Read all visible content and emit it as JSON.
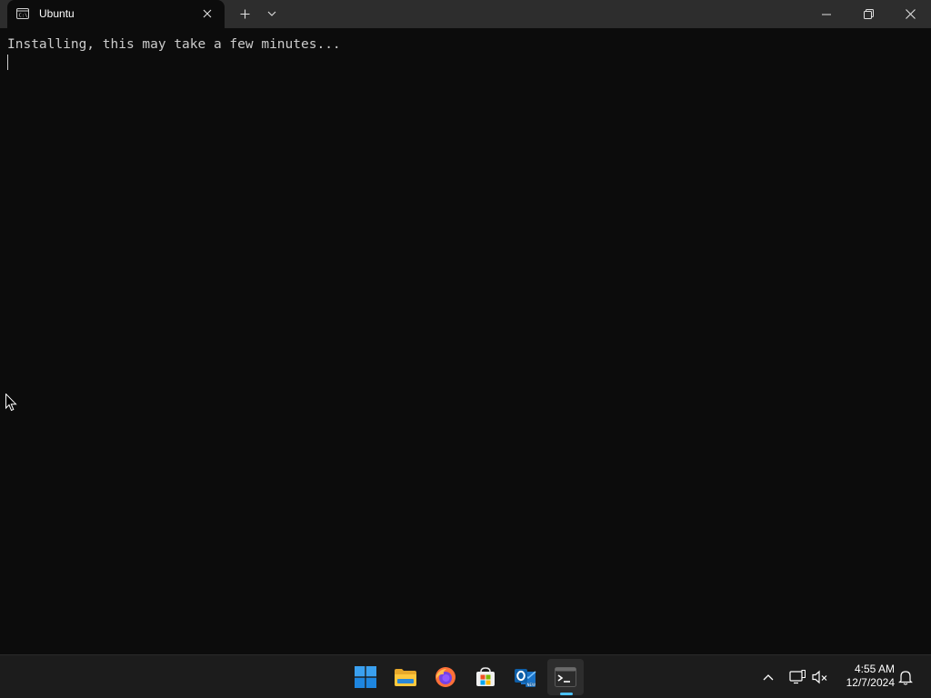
{
  "window": {
    "tab": {
      "title": "Ubuntu",
      "icon": "terminal-tab-icon"
    },
    "controls": {
      "new_tab_icon": "plus-icon",
      "dropdown_icon": "chevron-down-icon",
      "minimize_icon": "minimize-icon",
      "maximize_icon": "restore-icon",
      "close_icon": "close-icon"
    }
  },
  "terminal": {
    "lines": [
      "Installing, this may take a few minutes..."
    ],
    "text_color": "#cccccc",
    "background": "#0c0c0c"
  },
  "taskbar": {
    "apps": [
      {
        "name": "Start",
        "icon": "windows-start-icon",
        "active": false
      },
      {
        "name": "File Explorer",
        "icon": "file-explorer-icon",
        "active": false
      },
      {
        "name": "Firefox",
        "icon": "firefox-icon",
        "active": false
      },
      {
        "name": "Microsoft Store",
        "icon": "store-icon",
        "active": false
      },
      {
        "name": "Outlook",
        "icon": "outlook-icon",
        "active": false
      },
      {
        "name": "Terminal",
        "icon": "terminal-icon",
        "active": true
      }
    ],
    "tray": {
      "icons": [
        "chevron-up-icon",
        "network-icon",
        "volume-muted-icon",
        "notification-bell-icon"
      ],
      "time": "4:55 AM",
      "date": "12/7/2024"
    },
    "accent": "#4cc2ff"
  }
}
